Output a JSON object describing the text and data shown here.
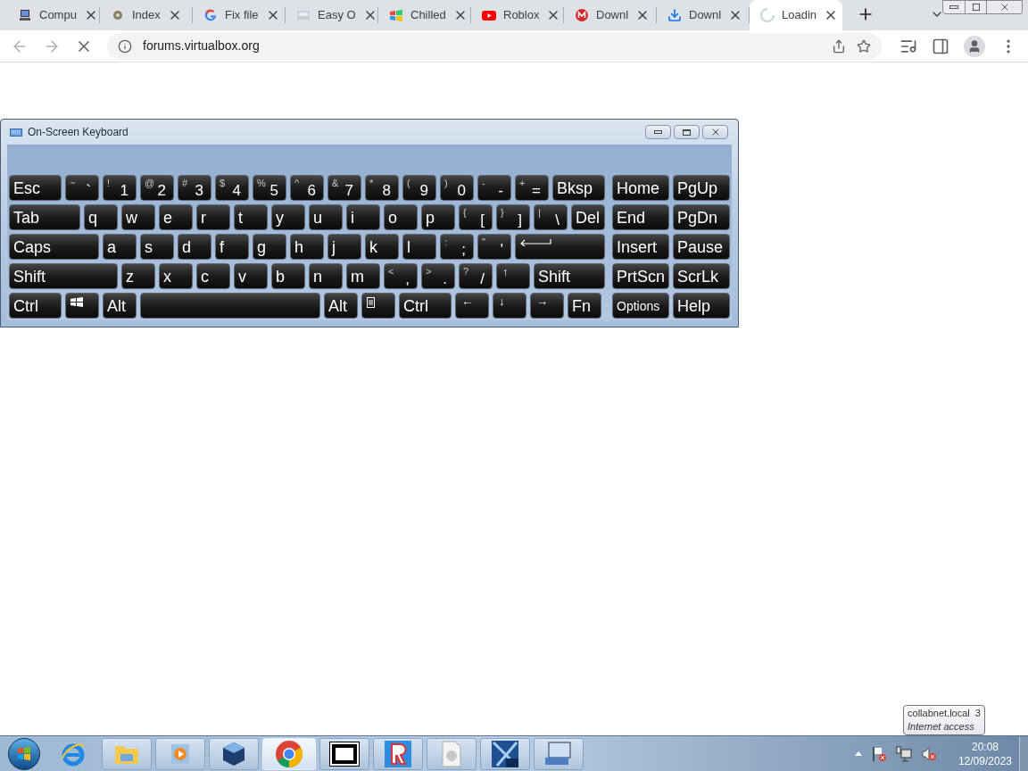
{
  "browser": {
    "tabs": [
      {
        "title": "Compu",
        "selected": false
      },
      {
        "title": "Index",
        "selected": false
      },
      {
        "title": "Fix file",
        "selected": false
      },
      {
        "title": "Easy O",
        "selected": false
      },
      {
        "title": "Chilled",
        "selected": false
      },
      {
        "title": "Roblox",
        "selected": false
      },
      {
        "title": "Downl",
        "selected": false
      },
      {
        "title": "Downl",
        "selected": false
      },
      {
        "title": "Loadin",
        "selected": true
      }
    ],
    "address": "forums.virtualbox.org"
  },
  "keyboard": {
    "title": "On-Screen Keyboard",
    "main_rows": [
      [
        {
          "kind": "text",
          "label": "Esc"
        },
        {
          "kind": "shifted",
          "shift": "~",
          "label": "`"
        },
        {
          "kind": "shifted",
          "shift": "!",
          "label": "1"
        },
        {
          "kind": "shifted",
          "shift": "@",
          "label": "2"
        },
        {
          "kind": "shifted",
          "shift": "#",
          "label": "3"
        },
        {
          "kind": "shifted",
          "shift": "$",
          "label": "4"
        },
        {
          "kind": "shifted",
          "shift": "%",
          "label": "5"
        },
        {
          "kind": "shifted",
          "shift": "^",
          "label": "6"
        },
        {
          "kind": "shifted",
          "shift": "&",
          "label": "7"
        },
        {
          "kind": "shifted",
          "shift": "*",
          "label": "8"
        },
        {
          "kind": "shifted",
          "shift": "(",
          "label": "9"
        },
        {
          "kind": "shifted",
          "shift": ")",
          "label": "0"
        },
        {
          "kind": "shifted",
          "shift": "-",
          "label": "-"
        },
        {
          "kind": "shifted",
          "shift": "+",
          "label": "="
        },
        {
          "kind": "text",
          "label": "Bksp"
        }
      ],
      [
        {
          "kind": "text",
          "label": "Tab"
        },
        {
          "kind": "text",
          "label": "q"
        },
        {
          "kind": "text",
          "label": "w"
        },
        {
          "kind": "text",
          "label": "e"
        },
        {
          "kind": "text",
          "label": "r"
        },
        {
          "kind": "text",
          "label": "t"
        },
        {
          "kind": "text",
          "label": "y"
        },
        {
          "kind": "text",
          "label": "u"
        },
        {
          "kind": "text",
          "label": "i"
        },
        {
          "kind": "text",
          "label": "o"
        },
        {
          "kind": "text",
          "label": "p"
        },
        {
          "kind": "shifted",
          "shift": "{",
          "label": "["
        },
        {
          "kind": "shifted",
          "shift": "}",
          "label": "]"
        },
        {
          "kind": "shifted",
          "shift": "|",
          "label": "\\"
        },
        {
          "kind": "text",
          "label": "Del"
        }
      ],
      [
        {
          "kind": "text",
          "label": "Caps"
        },
        {
          "kind": "text",
          "label": "a"
        },
        {
          "kind": "text",
          "label": "s"
        },
        {
          "kind": "text",
          "label": "d"
        },
        {
          "kind": "text",
          "label": "f"
        },
        {
          "kind": "text",
          "label": "g"
        },
        {
          "kind": "text",
          "label": "h"
        },
        {
          "kind": "text",
          "label": "j"
        },
        {
          "kind": "text",
          "label": "k"
        },
        {
          "kind": "text",
          "label": "l"
        },
        {
          "kind": "shifted",
          "shift": ":",
          "label": ";"
        },
        {
          "kind": "shifted",
          "shift": "\"",
          "label": "'"
        },
        {
          "kind": "enter"
        }
      ],
      [
        {
          "kind": "text",
          "label": "Shift"
        },
        {
          "kind": "text",
          "label": "z"
        },
        {
          "kind": "text",
          "label": "x"
        },
        {
          "kind": "text",
          "label": "c"
        },
        {
          "kind": "text",
          "label": "v"
        },
        {
          "kind": "text",
          "label": "b"
        },
        {
          "kind": "text",
          "label": "n"
        },
        {
          "kind": "text",
          "label": "m"
        },
        {
          "kind": "shifted",
          "shift": "<",
          "label": ","
        },
        {
          "kind": "shifted",
          "shift": ">",
          "label": "."
        },
        {
          "kind": "shifted",
          "shift": "?",
          "label": "/"
        },
        {
          "kind": "arrow",
          "label": "↑"
        },
        {
          "kind": "text",
          "label": "Shift"
        }
      ],
      [
        {
          "kind": "text",
          "label": "Ctrl"
        },
        {
          "kind": "windows"
        },
        {
          "kind": "text",
          "label": "Alt"
        },
        {
          "kind": "space"
        },
        {
          "kind": "text",
          "label": "Alt"
        },
        {
          "kind": "menu"
        },
        {
          "kind": "text",
          "label": "Ctrl"
        },
        {
          "kind": "arrow",
          "label": "←"
        },
        {
          "kind": "arrow",
          "label": "↓"
        },
        {
          "kind": "arrow",
          "label": "→"
        },
        {
          "kind": "text",
          "label": "Fn"
        }
      ]
    ],
    "nav_rows": [
      [
        {
          "kind": "text",
          "label": "Home"
        },
        {
          "kind": "text",
          "label": "PgUp"
        }
      ],
      [
        {
          "kind": "text",
          "label": "End"
        },
        {
          "kind": "text",
          "label": "PgDn"
        }
      ],
      [
        {
          "kind": "text",
          "label": "Insert"
        },
        {
          "kind": "text",
          "label": "Pause"
        }
      ],
      [
        {
          "kind": "text",
          "label": "PrtScn"
        },
        {
          "kind": "text",
          "label": "ScrLk"
        }
      ],
      [
        {
          "kind": "small",
          "label": "Options"
        },
        {
          "kind": "text",
          "label": "Help"
        }
      ]
    ]
  },
  "taskbar": {
    "apps": [
      {
        "running": false,
        "selected": false
      },
      {
        "running": true,
        "selected": false
      },
      {
        "running": true,
        "selected": false
      },
      {
        "running": true,
        "selected": false
      },
      {
        "running": true,
        "selected": true
      },
      {
        "running": true,
        "selected": false
      },
      {
        "running": true,
        "selected": false
      },
      {
        "running": true,
        "selected": false
      },
      {
        "running": true,
        "selected": false
      },
      {
        "running": true,
        "selected": false
      }
    ],
    "tooltip": {
      "title": "collabnet.local  3",
      "subtitle": "Internet access"
    },
    "time": "20:08",
    "date": "12/09/2023"
  }
}
